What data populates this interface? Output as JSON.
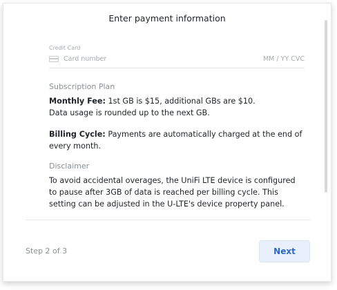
{
  "dialog": {
    "title": "Enter payment information"
  },
  "credit_card": {
    "label": "Credit Card",
    "icon": "credit-card-icon",
    "number_placeholder": "Card number",
    "expiry_cvc_placeholder": "MM / YY  CVC"
  },
  "subscription": {
    "heading": "Subscription Plan",
    "monthly_fee_label": "Monthly Fee:",
    "monthly_fee_text": "1st GB is $15, additional GBs are $10.",
    "monthly_fee_note": "Data usage is rounded up to the next GB.",
    "billing_cycle_label": "Billing Cycle:",
    "billing_cycle_text": "Payments are automatically charged at the end of every month."
  },
  "disclaimer": {
    "heading": "Disclaimer",
    "text": "To avoid accidental overages, the UniFi LTE device is configured to pause after 3GB of data is reached per billing cycle. This setting can be adjusted in the U-LTE's device property panel."
  },
  "footer": {
    "step_text": "Step 2 of 3",
    "next_label": "Next"
  },
  "colors": {
    "accent": "#2d68c4",
    "button_bg": "#e8f0fb"
  }
}
